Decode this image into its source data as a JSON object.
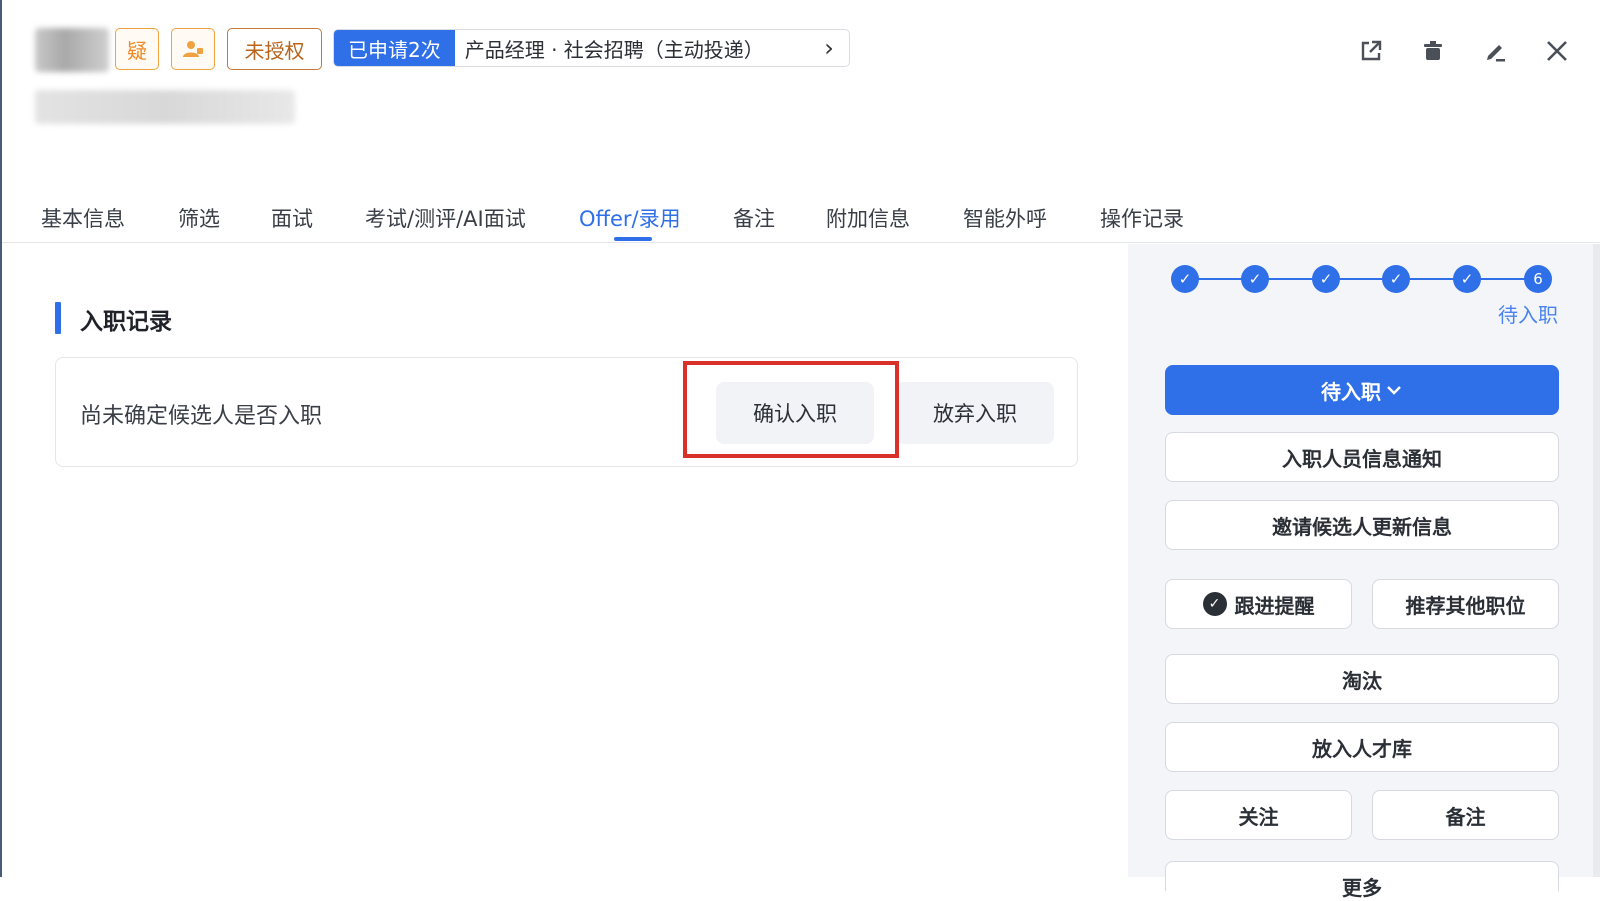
{
  "header": {
    "tags": {
      "doubt": "疑",
      "unauthorized": "未授权"
    },
    "apply": {
      "count_label": "已申请2次",
      "job_label": "产品经理 · 社会招聘（主动投递）",
      "chevron": "›"
    },
    "icons": [
      "share-icon",
      "delete-icon",
      "edit-icon",
      "close-icon"
    ]
  },
  "tabs": [
    {
      "label": "基本信息"
    },
    {
      "label": "筛选"
    },
    {
      "label": "面试"
    },
    {
      "label": "考试/测评/AI面试"
    },
    {
      "label": "Offer/录用"
    },
    {
      "label": "备注"
    },
    {
      "label": "附加信息"
    },
    {
      "label": "智能外呼"
    },
    {
      "label": "操作记录"
    }
  ],
  "active_tab": "Offer/录用",
  "onboarding": {
    "title": "入职记录",
    "status_text": "尚未确定候选人是否入职",
    "confirm_label": "确认入职",
    "abandon_label": "放弃入职"
  },
  "sidebar": {
    "current_step_number": "6",
    "current_step_label": "待入职",
    "status_dropdown": "待入职",
    "buttons": {
      "notify": "入职人员信息通知",
      "invite_update": "邀请候选人更新信息",
      "follow_reminder": "跟进提醒",
      "recommend_other": "推荐其他职位",
      "eliminate": "淘汰",
      "talent_pool": "放入人才库",
      "follow": "关注",
      "remark": "备注",
      "more": "更多"
    }
  },
  "colors": {
    "accent": "#2f6fe8",
    "highlight": "#d9312a",
    "tag_orange": "#f08a24"
  }
}
